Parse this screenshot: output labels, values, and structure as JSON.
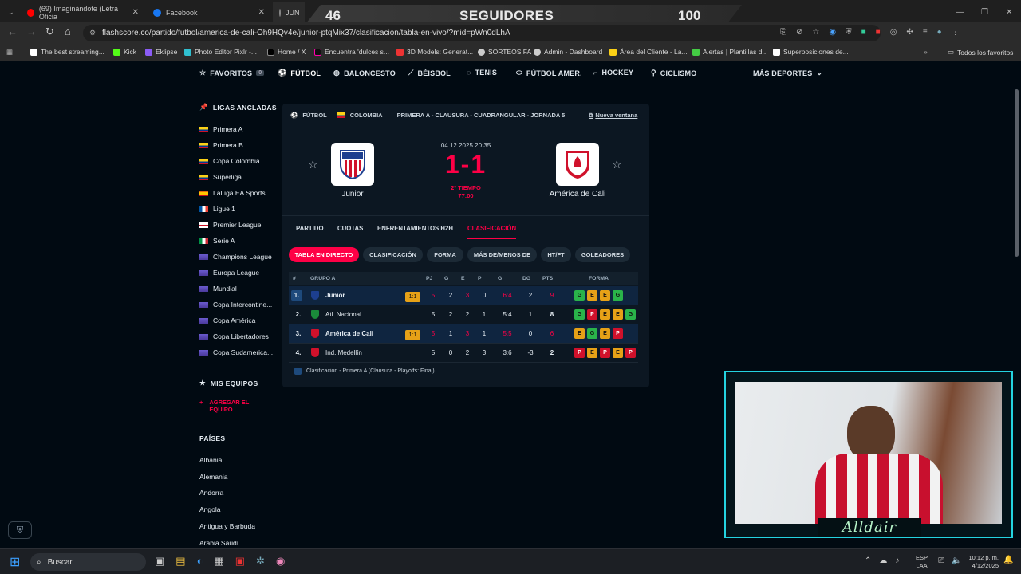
{
  "browser": {
    "tabs": [
      {
        "label": "(69) Imaginándote (Letra Oficia"
      },
      {
        "label": "Facebook"
      },
      {
        "label": "JUN"
      }
    ],
    "url": "flashscore.co/partido/futbol/america-de-cali-Oh9HQv4e/junior-ptqMix37/clasificacion/tabla-en-vivo/?mid=pWn0dLhA",
    "bookmarks": [
      "The best streaming...",
      "Kick",
      "Eklipse",
      "Photo Editor Pixlr -...",
      "Home / X",
      "Encuentra 'dulces s...",
      "3D Models: Generat...",
      "SORTEOS FA",
      "Admin - Dashboard",
      "Área del Cliente - La...",
      "Alertas | Plantillas d...",
      "Superposiciones de..."
    ],
    "bookmarks_all": "Todos los favoritos"
  },
  "stream": {
    "left": "46",
    "center": "SEGUIDORES",
    "right": "100"
  },
  "nav": {
    "favoritos": "FAVORITOS",
    "fav_count": "0",
    "items": [
      "FÚTBOL",
      "BALONCESTO",
      "BÉISBOL",
      "TENIS",
      "FÚTBOL AMER.",
      "HOCKEY",
      "CICLISMO"
    ],
    "more": "MÁS DEPORTES"
  },
  "sidebar": {
    "pinned_title": "LIGAS ANCLADAS",
    "leagues": [
      "Primera A",
      "Primera B",
      "Copa Colombia",
      "Superliga",
      "LaLiga EA Sports",
      "Ligue 1",
      "Premier League",
      "Serie A",
      "Champions League",
      "Europa League",
      "Mundial",
      "Copa Intercontine...",
      "Copa América",
      "Copa Libertadores",
      "Copa Sudamerica..."
    ],
    "teams_title": "MIS EQUIPOS",
    "add_team": "AGREGAR EL EQUIPO",
    "countries_title": "PAÍSES",
    "countries": [
      "Albania",
      "Alemania",
      "Andorra",
      "Angola",
      "Antigua y Barbuda",
      "Arabia Saudí"
    ]
  },
  "match": {
    "breadcrumb": {
      "sport": "FÚTBOL",
      "country": "COLOMBIA",
      "competition": "PRIMERA A - CLAUSURA - CUADRANGULAR - JORNADA 5"
    },
    "new_window": "Nueva ventana",
    "datetime": "04.12.2025 20:35",
    "score": "1-1",
    "status": "2º TIEMPO",
    "clock": "77:00",
    "home": "Junior",
    "away": "América de Cali",
    "tabs": [
      "PARTIDO",
      "CUOTAS",
      "ENFRENTAMIENTOS H2H",
      "CLASIFICACIÓN"
    ],
    "pills": [
      "TABLA EN DIRECTO",
      "CLASIFICACIÓN",
      "FORMA",
      "MÁS DE/MENOS DE",
      "HT/FT",
      "GOLEADORES"
    ]
  },
  "table": {
    "headers": {
      "pos": "#",
      "group": "GRUPO A",
      "pj": "PJ",
      "g": "G",
      "e": "E",
      "p": "P",
      "goals": "G",
      "dg": "DG",
      "pts": "PTS",
      "form": "FORMA"
    },
    "rows": [
      {
        "pos": "1.",
        "team": "Junior",
        "live": "1:1",
        "pj": "5",
        "g": "2",
        "e": "3",
        "p": "0",
        "goals": "6:4",
        "dg": "2",
        "pts": "9",
        "form": [
          "G",
          "E",
          "E",
          "G"
        ]
      },
      {
        "pos": "2.",
        "team": "Atl. Nacional",
        "live": "",
        "pj": "5",
        "g": "2",
        "e": "2",
        "p": "1",
        "goals": "5:4",
        "dg": "1",
        "pts": "8",
        "form": [
          "G",
          "P",
          "E",
          "E",
          "G"
        ]
      },
      {
        "pos": "3.",
        "team": "América de Cali",
        "live": "1:1",
        "pj": "5",
        "g": "1",
        "e": "3",
        "p": "1",
        "goals": "5:5",
        "dg": "0",
        "pts": "6",
        "form": [
          "E",
          "G",
          "E",
          "P"
        ]
      },
      {
        "pos": "4.",
        "team": "Ind. Medellín",
        "live": "",
        "pj": "5",
        "g": "0",
        "e": "2",
        "p": "3",
        "goals": "3:6",
        "dg": "-3",
        "pts": "2",
        "form": [
          "P",
          "E",
          "P",
          "E",
          "P"
        ]
      }
    ],
    "legend": "Clasificación - Primera A (Clausura - Playoffs: Final)"
  },
  "overlay": {
    "name": "Alldair"
  },
  "taskbar": {
    "search": "Buscar",
    "lang1": "ESP",
    "lang2": "LAA",
    "time": "10:12 p. m.",
    "date": "4/12/2025"
  },
  "colors": {
    "accent": "#ff0046",
    "bg": "#010a12",
    "panel": "#0c1722",
    "cam_border": "#24d3e0"
  }
}
